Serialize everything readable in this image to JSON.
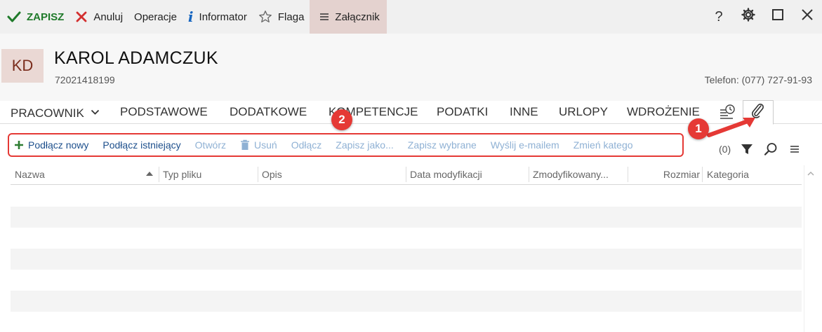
{
  "toolbar": {
    "save_label": "ZAPISZ",
    "cancel_label": "Anuluj",
    "operations_label": "Operacje",
    "informator_label": "Informator",
    "flag_label": "Flaga",
    "attachment_label": "Załącznik",
    "help_label": "?"
  },
  "employee": {
    "initials": "KD",
    "name": "KAROL ADAMCZUK",
    "id_number": "72021418199",
    "phone": "Telefon: (077) 727-91-93"
  },
  "tabs": [
    {
      "label": "PRACOWNIK"
    },
    {
      "label": "PODSTAWOWE"
    },
    {
      "label": "DODATKOWE"
    },
    {
      "label": "KOMPETENCJE"
    },
    {
      "label": "PODATKI"
    },
    {
      "label": "INNE"
    },
    {
      "label": "URLOPY"
    },
    {
      "label": "WDROŻENIE"
    }
  ],
  "actions": [
    {
      "label": "Podłącz nowy",
      "enabled": true
    },
    {
      "label": "Podłącz istniejący",
      "enabled": true
    },
    {
      "label": "Otwórz",
      "enabled": false
    },
    {
      "label": "Usuń",
      "enabled": false
    },
    {
      "label": "Odłącz",
      "enabled": false
    },
    {
      "label": "Zapisz jako...",
      "enabled": false
    },
    {
      "label": "Zapisz wybrane",
      "enabled": false
    },
    {
      "label": "Wyślij e-mailem",
      "enabled": false
    },
    {
      "label": "Zmień katego",
      "enabled": false
    }
  ],
  "grid": {
    "count": "(0)",
    "columns": [
      "Nazwa",
      "Typ pliku",
      "Opis",
      "Data modyfikacji",
      "Zmodyfikowany...",
      "Rozmiar",
      "Kategoria"
    ]
  },
  "annotations": {
    "badge_1": "1",
    "badge_2": "2"
  },
  "colors": {
    "accent_red": "#e53935",
    "save_green": "#1f7a2a",
    "link_blue": "#1d4f8c",
    "disabled_blue": "#8fb1d4",
    "active_tab_bg": "#e4d2cf"
  }
}
